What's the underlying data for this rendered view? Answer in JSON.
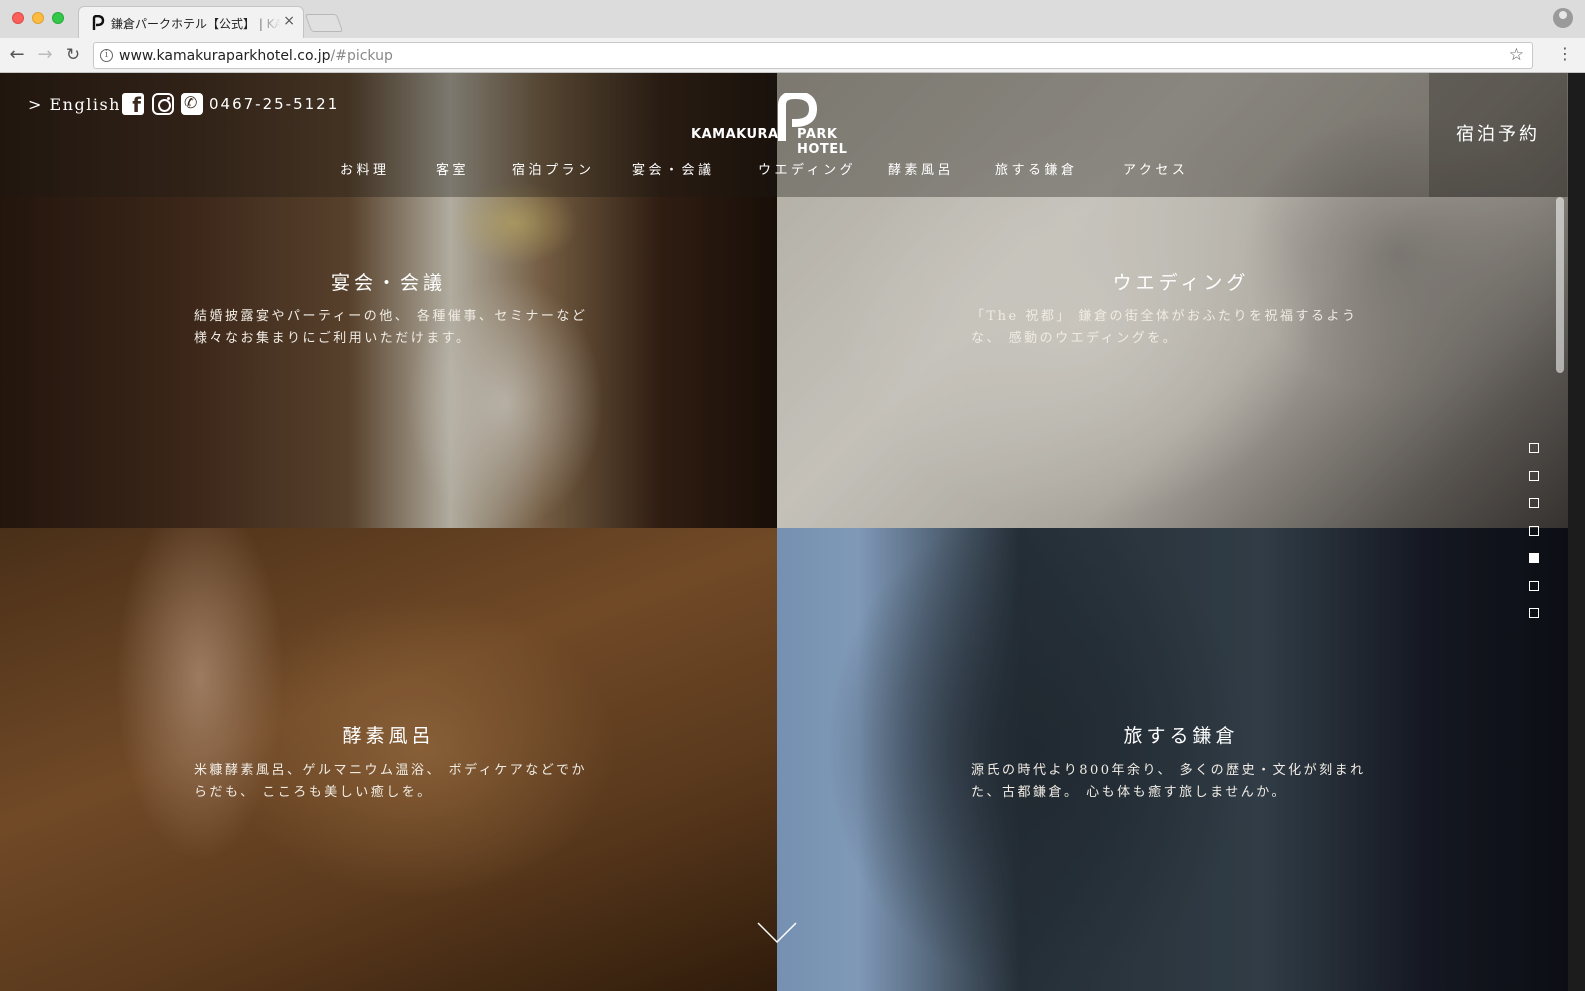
{
  "browser": {
    "tab_title": "鎌倉パークホテル【公式】 | KAMAKURA PARK HOTEL",
    "url_main": "www.kamakuraparkhotel.co.jp",
    "url_hash": "/#pickup",
    "close_glyph": "×"
  },
  "header": {
    "lang_link": "> English",
    "phone": "0467-25-5121",
    "logo_left": "KAMAKURA",
    "logo_right": "PARK HOTEL",
    "reserve": "宿泊予約",
    "nav": [
      "お料理",
      "客室",
      "宿泊プラン",
      "宴会・会議",
      "ウエディング",
      "酵素風呂",
      "旅する鎌倉",
      "アクセス"
    ]
  },
  "panels": {
    "banquet": {
      "title": "宴会・会議",
      "desc": "結婚披露宴やパーティーの他、 各種催事、セミナーなど 様々なお集まりにご利用いただけます。"
    },
    "wedding": {
      "title": "ウエディング",
      "desc": "「The 祝都」 鎌倉の街全体がおふたりを祝福するような、 感動のウエディングを。"
    },
    "enzyme": {
      "title": "酵素風呂",
      "desc": "米糠酵素風呂、ゲルマニウム温浴、 ボディケアなどでからだも、 こころも美しい癒しを。"
    },
    "travel": {
      "title": "旅する鎌倉",
      "desc": "源氏の時代より800年余り、 多くの歴史・文化が刻まれた、古都鎌倉。 心も体も癒す旅しませんか。"
    }
  },
  "side_nav": {
    "count": 7,
    "active_index": 4
  },
  "icons": [
    "facebook-icon",
    "instagram-icon",
    "phone-icon",
    "chevron-down-icon"
  ]
}
